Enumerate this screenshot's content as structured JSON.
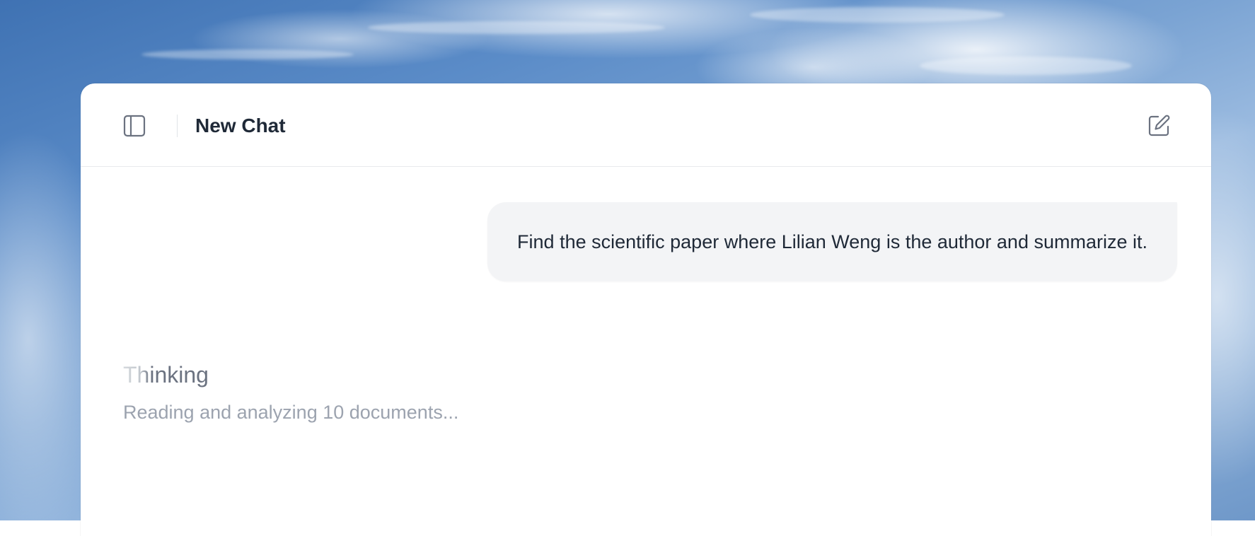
{
  "header": {
    "title": "New Chat",
    "sidebar_toggle_icon": "sidebar-panel-icon",
    "new_chat_icon": "edit-square-icon"
  },
  "conversation": {
    "user_message": "Find the scientific paper where Lilian Weng is the author and summarize it.",
    "assistant_status_title": "Thinking",
    "assistant_status_detail": "Reading and analyzing 10 documents..."
  },
  "colors": {
    "title_text": "#1f2937",
    "bubble_bg": "#f3f4f6",
    "thinking_text": "#6b7280",
    "status_text": "#9ca3af",
    "icon_stroke": "#6b7280"
  }
}
